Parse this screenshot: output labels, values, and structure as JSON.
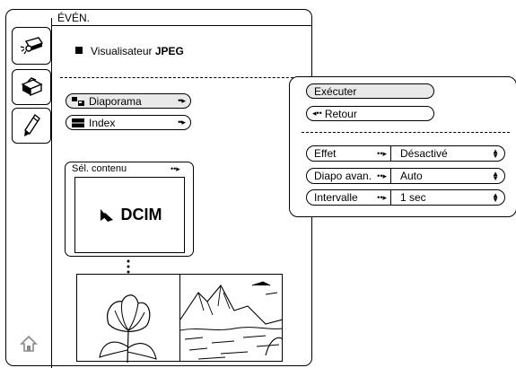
{
  "window": {
    "title": "ÉVÉN."
  },
  "sidebar": {
    "tabs": [
      {
        "icon": "projector-icon"
      },
      {
        "icon": "toolbox-icon"
      },
      {
        "icon": "pen-icon"
      }
    ],
    "home_icon": "home-icon"
  },
  "main": {
    "viewer_prefix": "Visualisateur ",
    "viewer_bold": "JPEG",
    "buttons": [
      {
        "label": "Diaporama",
        "arrow": "••▸"
      },
      {
        "label": "Index",
        "arrow": "••▸"
      }
    ],
    "content_selector": {
      "label": "Sél. contenu",
      "arrow": "••▸",
      "folder": "DCIM"
    }
  },
  "panel": {
    "execute_label": "Exécuter",
    "back_label": "Retour",
    "back_arrow": "◂••",
    "settings": [
      {
        "label": "Effet",
        "value": "Désactivé"
      },
      {
        "label": "Diapo avan.",
        "value": "Auto"
      },
      {
        "label": "Intervalle",
        "value": "1 sec"
      }
    ],
    "arrow": "••▸"
  }
}
